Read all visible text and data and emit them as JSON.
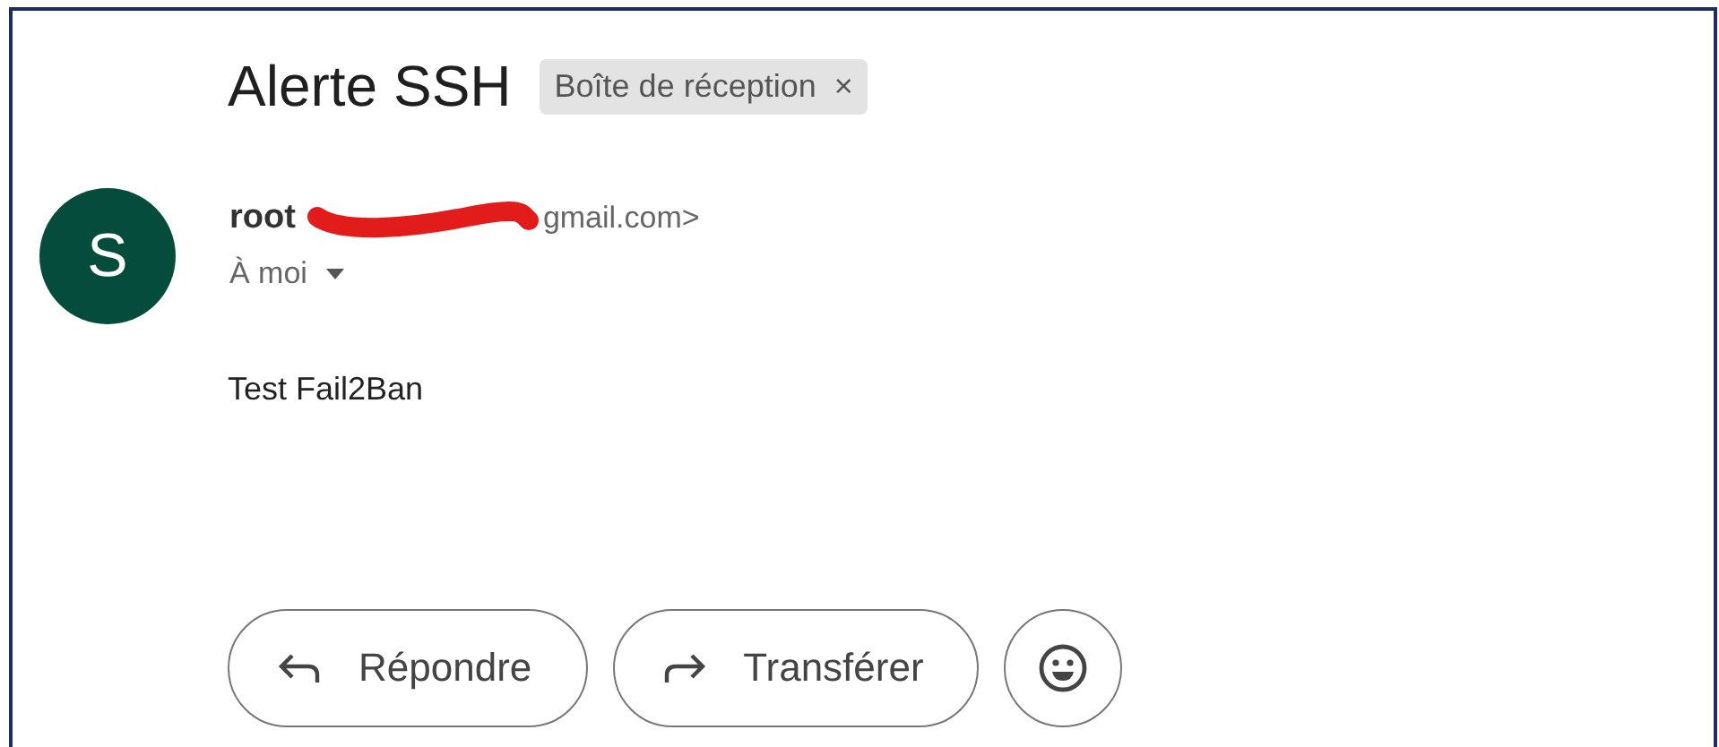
{
  "subject": "Alerte SSH",
  "label_chip": {
    "label": "Boîte de réception",
    "close": "×"
  },
  "sender": {
    "avatar_letter": "S",
    "name": "root",
    "email": "gmail.com>",
    "recipient": "À moi"
  },
  "body": "Test Fail2Ban",
  "actions": [
    {
      "kind": "reply",
      "label": "Répondre"
    },
    {
      "kind": "forward",
      "label": "Transférer"
    },
    {
      "kind": "emoji"
    }
  ]
}
